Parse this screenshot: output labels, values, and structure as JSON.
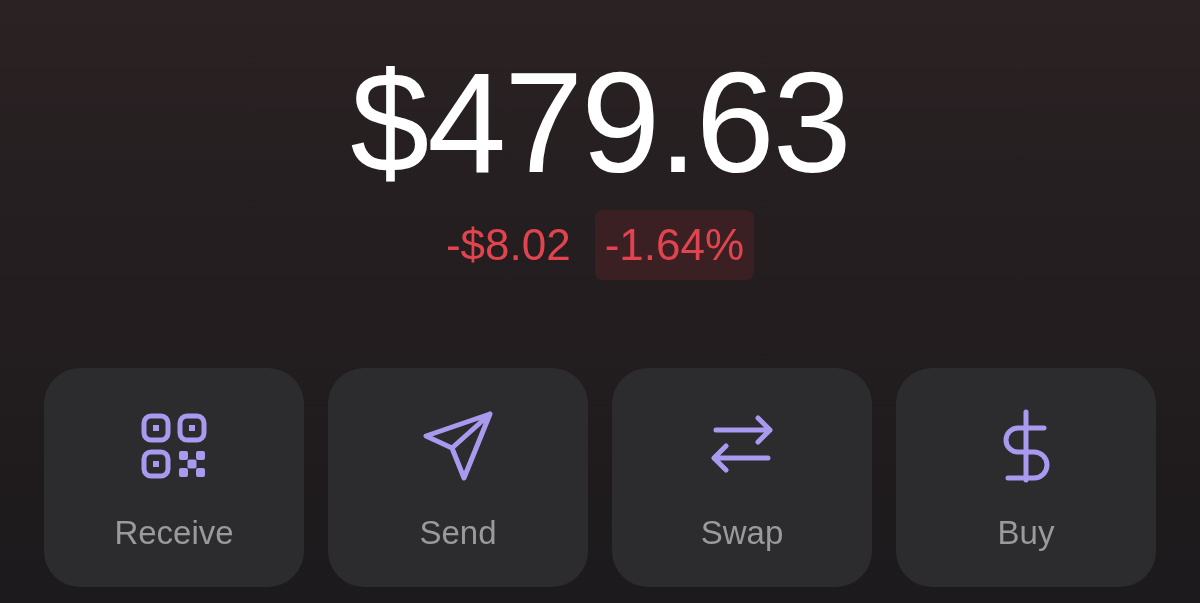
{
  "balance": "$479.63",
  "change": {
    "amount": "-$8.02",
    "percent": "-1.64%"
  },
  "actions": [
    {
      "label": "Receive",
      "kind": "qr"
    },
    {
      "label": "Send",
      "kind": "send"
    },
    {
      "label": "Swap",
      "kind": "swap"
    },
    {
      "label": "Buy",
      "kind": "dollar"
    }
  ]
}
